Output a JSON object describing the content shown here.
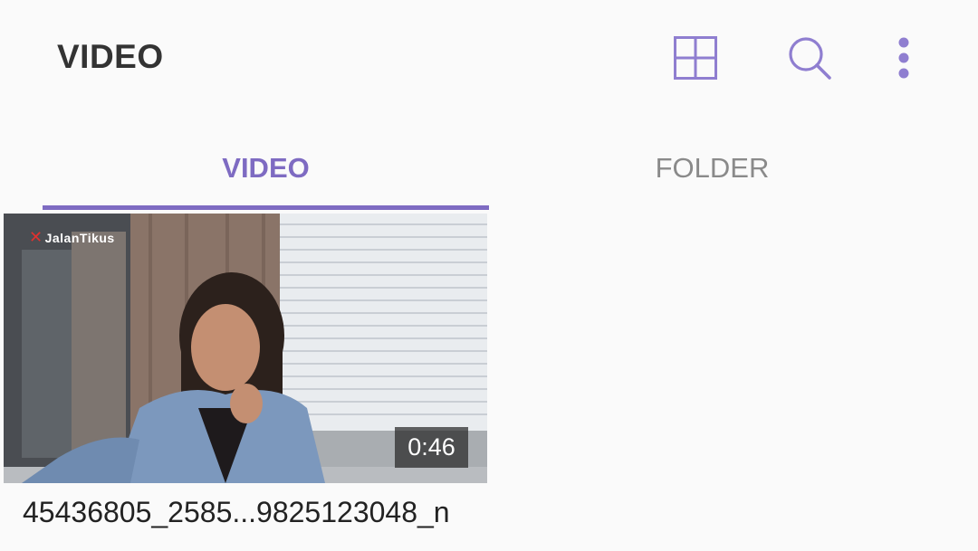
{
  "header": {
    "title": "VIDEO",
    "icons": [
      "grid-view-icon",
      "search-icon",
      "more-options-icon"
    ]
  },
  "tabs": [
    {
      "label": "VIDEO",
      "selected": true
    },
    {
      "label": "FOLDER",
      "selected": false
    }
  ],
  "colors": {
    "accent": "#7e6bc2",
    "background": "#fafafa",
    "inactive_tab": "#8a8a8a",
    "title": "#333333"
  },
  "videos": [
    {
      "watermark": "JalanTikus",
      "duration": "0:46",
      "filename": "45436805_2585...9825123048_n"
    }
  ]
}
